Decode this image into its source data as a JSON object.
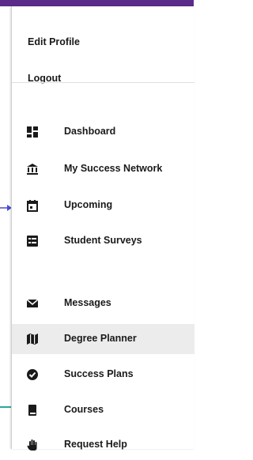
{
  "account": {
    "edit_profile": "Edit Profile",
    "logout": "Logout"
  },
  "nav": {
    "items": [
      {
        "label": "Dashboard",
        "icon": "dashboard-icon"
      },
      {
        "label": "My Success Network",
        "icon": "institution-icon"
      },
      {
        "label": "Upcoming",
        "icon": "calendar-icon"
      },
      {
        "label": "Student Surveys",
        "icon": "survey-icon"
      },
      {
        "label": "Messages",
        "icon": "envelope-icon"
      },
      {
        "label": "Degree Planner",
        "icon": "map-icon",
        "active": true
      },
      {
        "label": "Success Plans",
        "icon": "check-circle-icon"
      },
      {
        "label": "Courses",
        "icon": "book-icon"
      },
      {
        "label": "Request Help",
        "icon": "hand-icon"
      }
    ]
  },
  "colors": {
    "brand": "#5b2b8a",
    "accent_line": "#2aa79b",
    "active_bg": "#ececec"
  }
}
